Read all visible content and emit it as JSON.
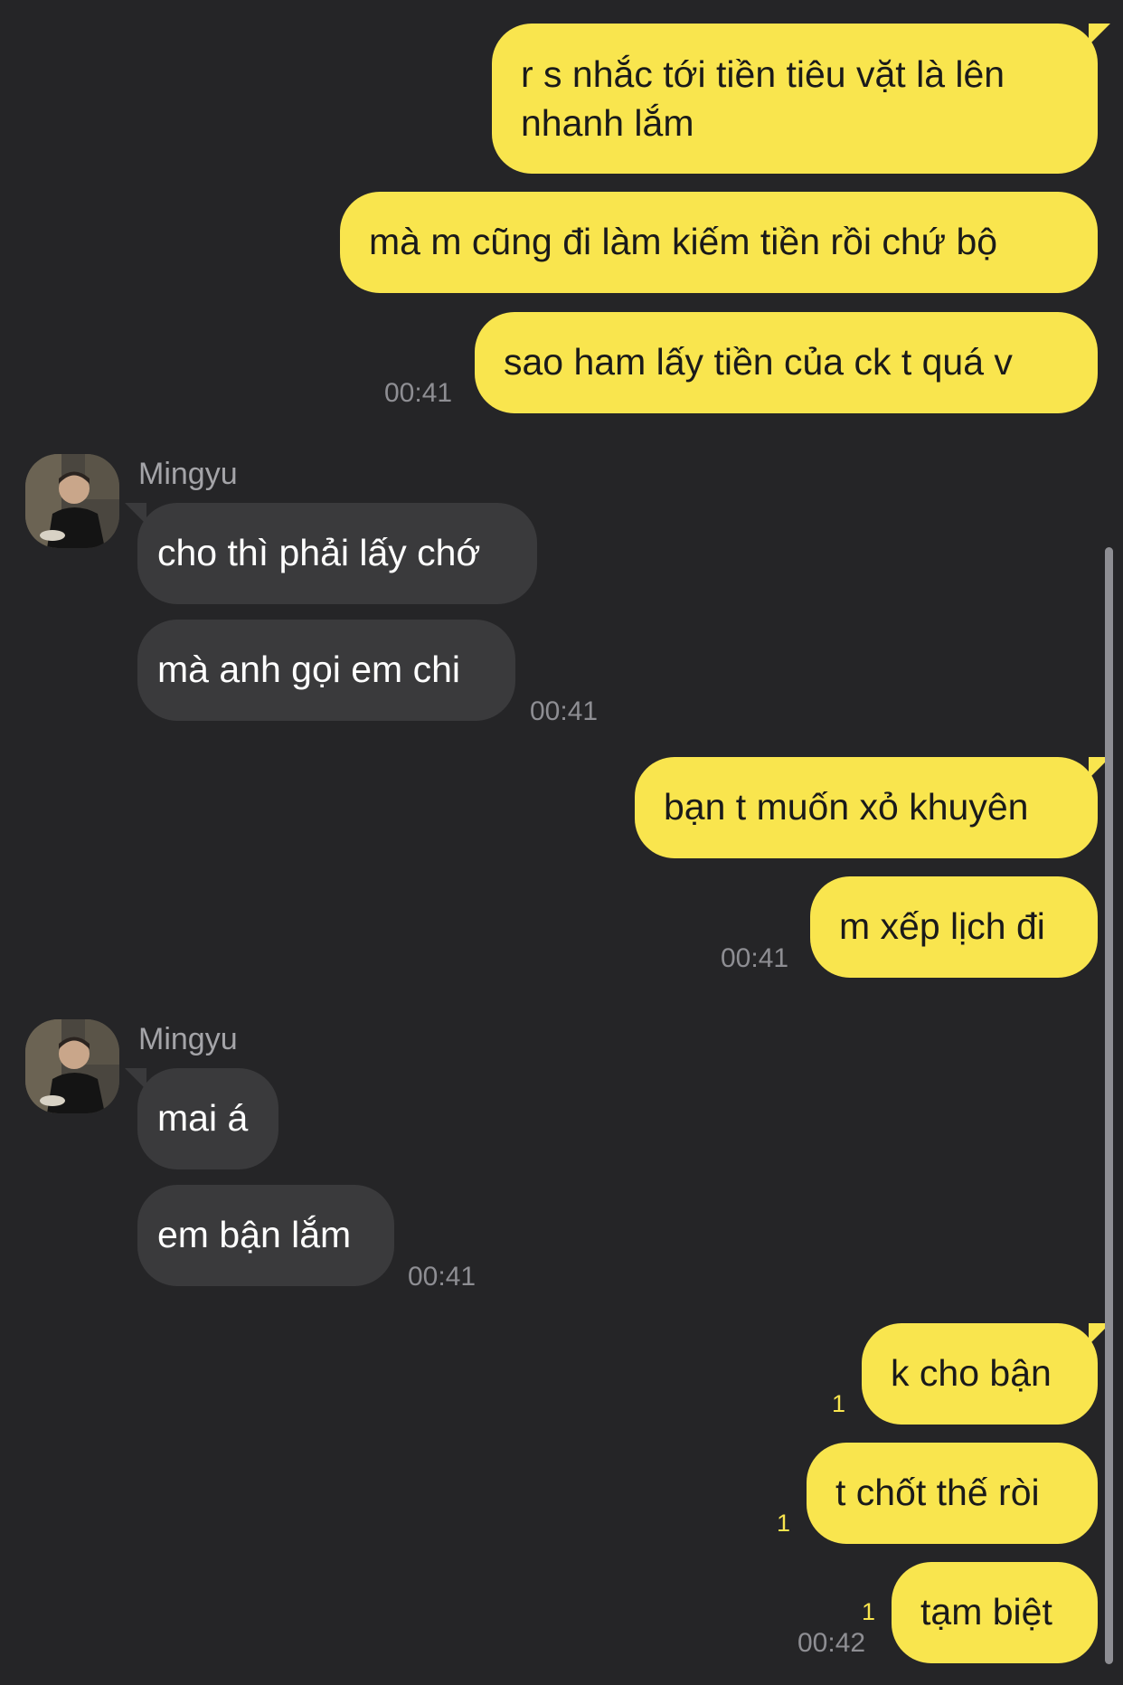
{
  "conversation": {
    "messages": [
      {
        "text": "r s nhắc tới tiền tiêu vặt là lên\nnhanh lắm"
      },
      {
        "text": "mà m cũng đi làm kiếm tiền rồi chứ bộ"
      },
      {
        "text": "sao ham lấy tiền của ck t quá v",
        "time": "00:41"
      },
      {
        "sender": "Mingyu",
        "text": "cho thì phải lấy chớ"
      },
      {
        "text": "mà anh gọi em chi",
        "time": "00:41"
      },
      {
        "text": "bạn t muốn xỏ khuyên"
      },
      {
        "text": "m xếp lịch đi",
        "time": "00:41"
      },
      {
        "sender": "Mingyu",
        "text": "mai á"
      },
      {
        "text": "em bận lắm",
        "time": "00:41"
      },
      {
        "text": "k cho bận",
        "unread": "1"
      },
      {
        "text": "t chốt thế ròi",
        "unread": "1"
      },
      {
        "text": "tạm biệt",
        "unread": "1",
        "time": "00:42"
      }
    ]
  },
  "colors": {
    "background": "#252527",
    "sent_bubble": "#f9e54e",
    "received_bubble": "#3a3a3c",
    "timestamp": "#8e8e93",
    "unread_count": "#f9e54e"
  },
  "icons": {
    "avatar": "profile-photo"
  }
}
